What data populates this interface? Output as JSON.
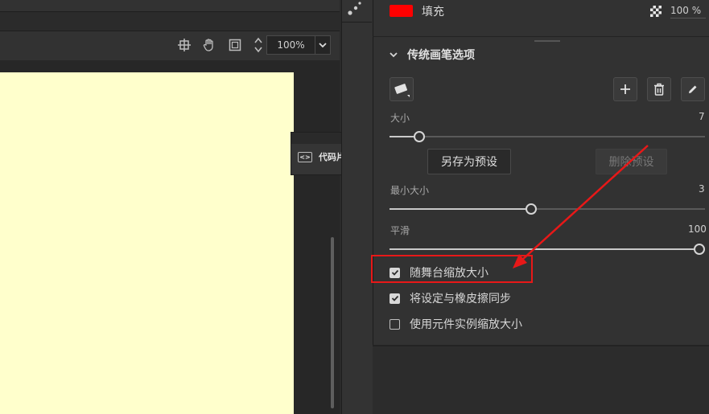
{
  "toolbar": {
    "zoom_value": "100%",
    "icons": [
      "crosshair-icon",
      "hand-icon",
      "fit-frame-icon",
      "zoom-stepper-icon"
    ]
  },
  "snippet_panel": {
    "title": "代码片断",
    "icon": "code-icon"
  },
  "fill": {
    "label": "填充",
    "color": "#ff0000",
    "alpha": "100 %"
  },
  "section": {
    "title": "传统画笔选项"
  },
  "brush": {
    "size_label": "大小",
    "size_value": "7",
    "size_fraction": 0.05,
    "save_preset": "另存为预设",
    "delete_preset": "删除预设",
    "min_size_label": "最小大小",
    "min_size_value": "3",
    "min_size_fraction": 0.43,
    "smooth_label": "平滑",
    "smooth_value": "100",
    "smooth_fraction": 1.0
  },
  "options": [
    {
      "label": "随舞台缩放大小",
      "checked": true
    },
    {
      "label": "将设定与橡皮擦同步",
      "checked": true
    },
    {
      "label": "使用元件实例缩放大小",
      "checked": false
    }
  ],
  "colors": {
    "accent_red": "#e81818",
    "stage": "#ffffcc"
  }
}
